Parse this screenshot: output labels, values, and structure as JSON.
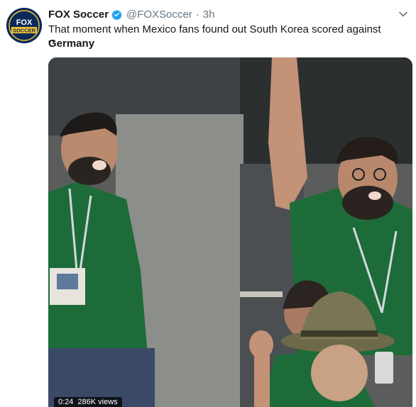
{
  "tweet": {
    "author_name": "FOX Soccer",
    "handle": "@FOXSoccer",
    "separator": "·",
    "time": "3h",
    "text_before": "That moment when Mexico fans found out South Korea scored against ",
    "text_bold": "Germany",
    "text_extra": "••",
    "avatar_text_top": "FOX",
    "avatar_text_bottom": "SOCCER"
  },
  "media": {
    "duration": "0:24",
    "views": "286K views"
  },
  "colors": {
    "verified": "#1da1f2",
    "jersey": "#1e6b3a",
    "avatar_bg": "#0b2a5b",
    "avatar_accent": "#f2c230"
  }
}
